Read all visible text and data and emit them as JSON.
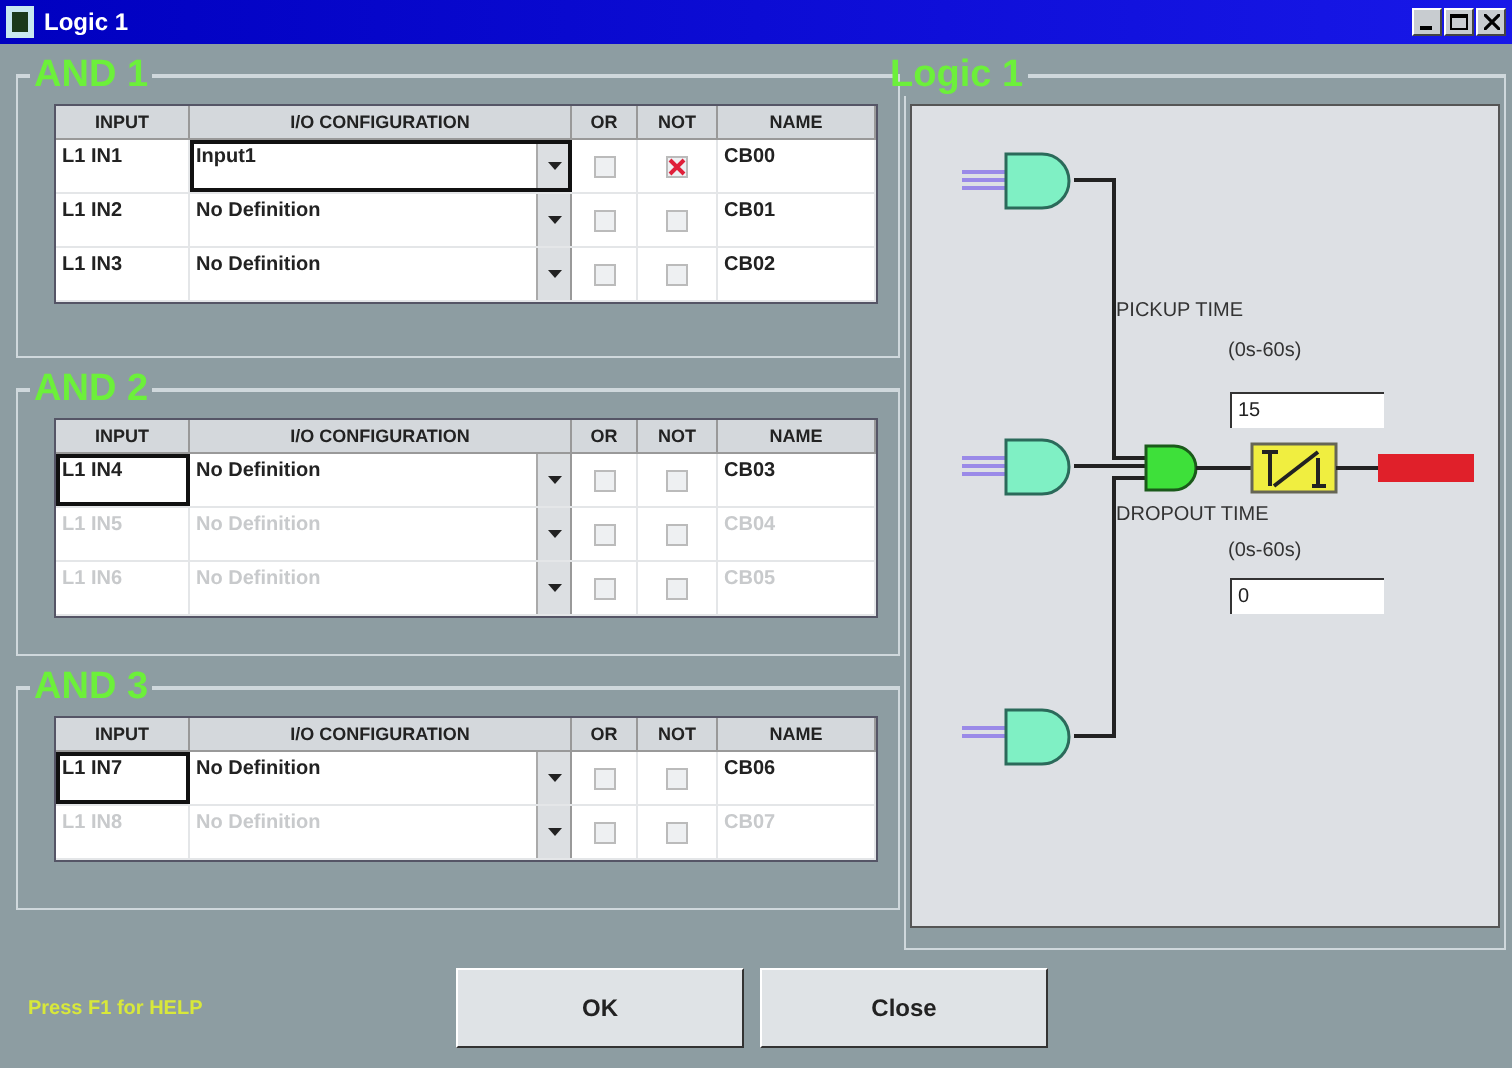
{
  "window": {
    "title": "Logic 1"
  },
  "groups": [
    {
      "title": "AND 1",
      "columns": [
        "INPUT",
        "I/O CONFIGURATION",
        "OR",
        "NOT",
        "NAME"
      ],
      "rows": [
        {
          "input": "L1 IN1",
          "config": "Input1",
          "or": false,
          "not": true,
          "name": "CB00",
          "disabled": false,
          "input_focused": false,
          "config_focused": true
        },
        {
          "input": "L1 IN2",
          "config": "No Definition",
          "or": false,
          "not": false,
          "name": "CB01",
          "disabled": false,
          "input_focused": false,
          "config_focused": false
        },
        {
          "input": "L1 IN3",
          "config": "No Definition",
          "or": false,
          "not": false,
          "name": "CB02",
          "disabled": false,
          "input_focused": false,
          "config_focused": false
        }
      ]
    },
    {
      "title": "AND 2",
      "columns": [
        "INPUT",
        "I/O CONFIGURATION",
        "OR",
        "NOT",
        "NAME"
      ],
      "rows": [
        {
          "input": "L1 IN4",
          "config": "No Definition",
          "or": false,
          "not": false,
          "name": "CB03",
          "disabled": false,
          "input_focused": true,
          "config_focused": false
        },
        {
          "input": "L1 IN5",
          "config": "No Definition",
          "or": false,
          "not": false,
          "name": "CB04",
          "disabled": true,
          "input_focused": false,
          "config_focused": false
        },
        {
          "input": "L1 IN6",
          "config": "No Definition",
          "or": false,
          "not": false,
          "name": "CB05",
          "disabled": true,
          "input_focused": false,
          "config_focused": false
        }
      ]
    },
    {
      "title": "AND 3",
      "columns": [
        "INPUT",
        "I/O CONFIGURATION",
        "OR",
        "NOT",
        "NAME"
      ],
      "rows": [
        {
          "input": "L1 IN7",
          "config": "No Definition",
          "or": false,
          "not": false,
          "name": "CB06",
          "disabled": false,
          "input_focused": true,
          "config_focused": false
        },
        {
          "input": "L1 IN8",
          "config": "No Definition",
          "or": false,
          "not": false,
          "name": "CB07",
          "disabled": true,
          "input_focused": false,
          "config_focused": false
        }
      ]
    }
  ],
  "diagram": {
    "title": "Logic 1",
    "pickup": {
      "label": "PICKUP TIME",
      "range": "(0s-60s)",
      "value": "15"
    },
    "dropout": {
      "label": "DROPOUT TIME",
      "range": "(0s-60s)",
      "value": "0"
    }
  },
  "help": "Press F1 for HELP",
  "buttons": [
    "OK",
    "Close"
  ]
}
